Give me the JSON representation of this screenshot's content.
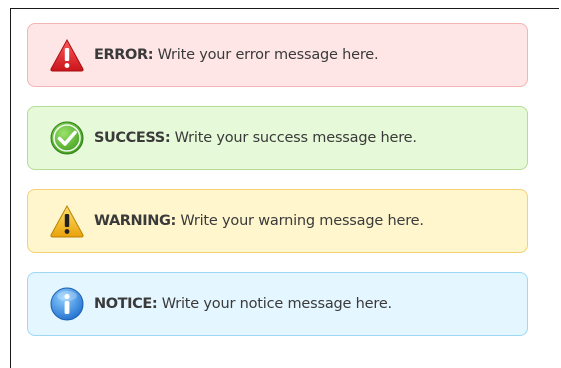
{
  "alerts": {
    "error": {
      "icon": "error-triangle-icon",
      "label": "ERROR:",
      "text": "Write your error message here.",
      "color": "#e82b2b"
    },
    "success": {
      "icon": "success-check-icon",
      "label": "SUCCESS:",
      "text": "Write your success message here.",
      "color": "#4fb62a"
    },
    "warning": {
      "icon": "warning-triangle-icon",
      "label": "WARNING:",
      "text": "Write your warning message here.",
      "color": "#f3b318"
    },
    "notice": {
      "icon": "info-circle-icon",
      "label": "NOTICE:",
      "text": "Write your notice message here.",
      "color": "#2b8fe6"
    }
  }
}
